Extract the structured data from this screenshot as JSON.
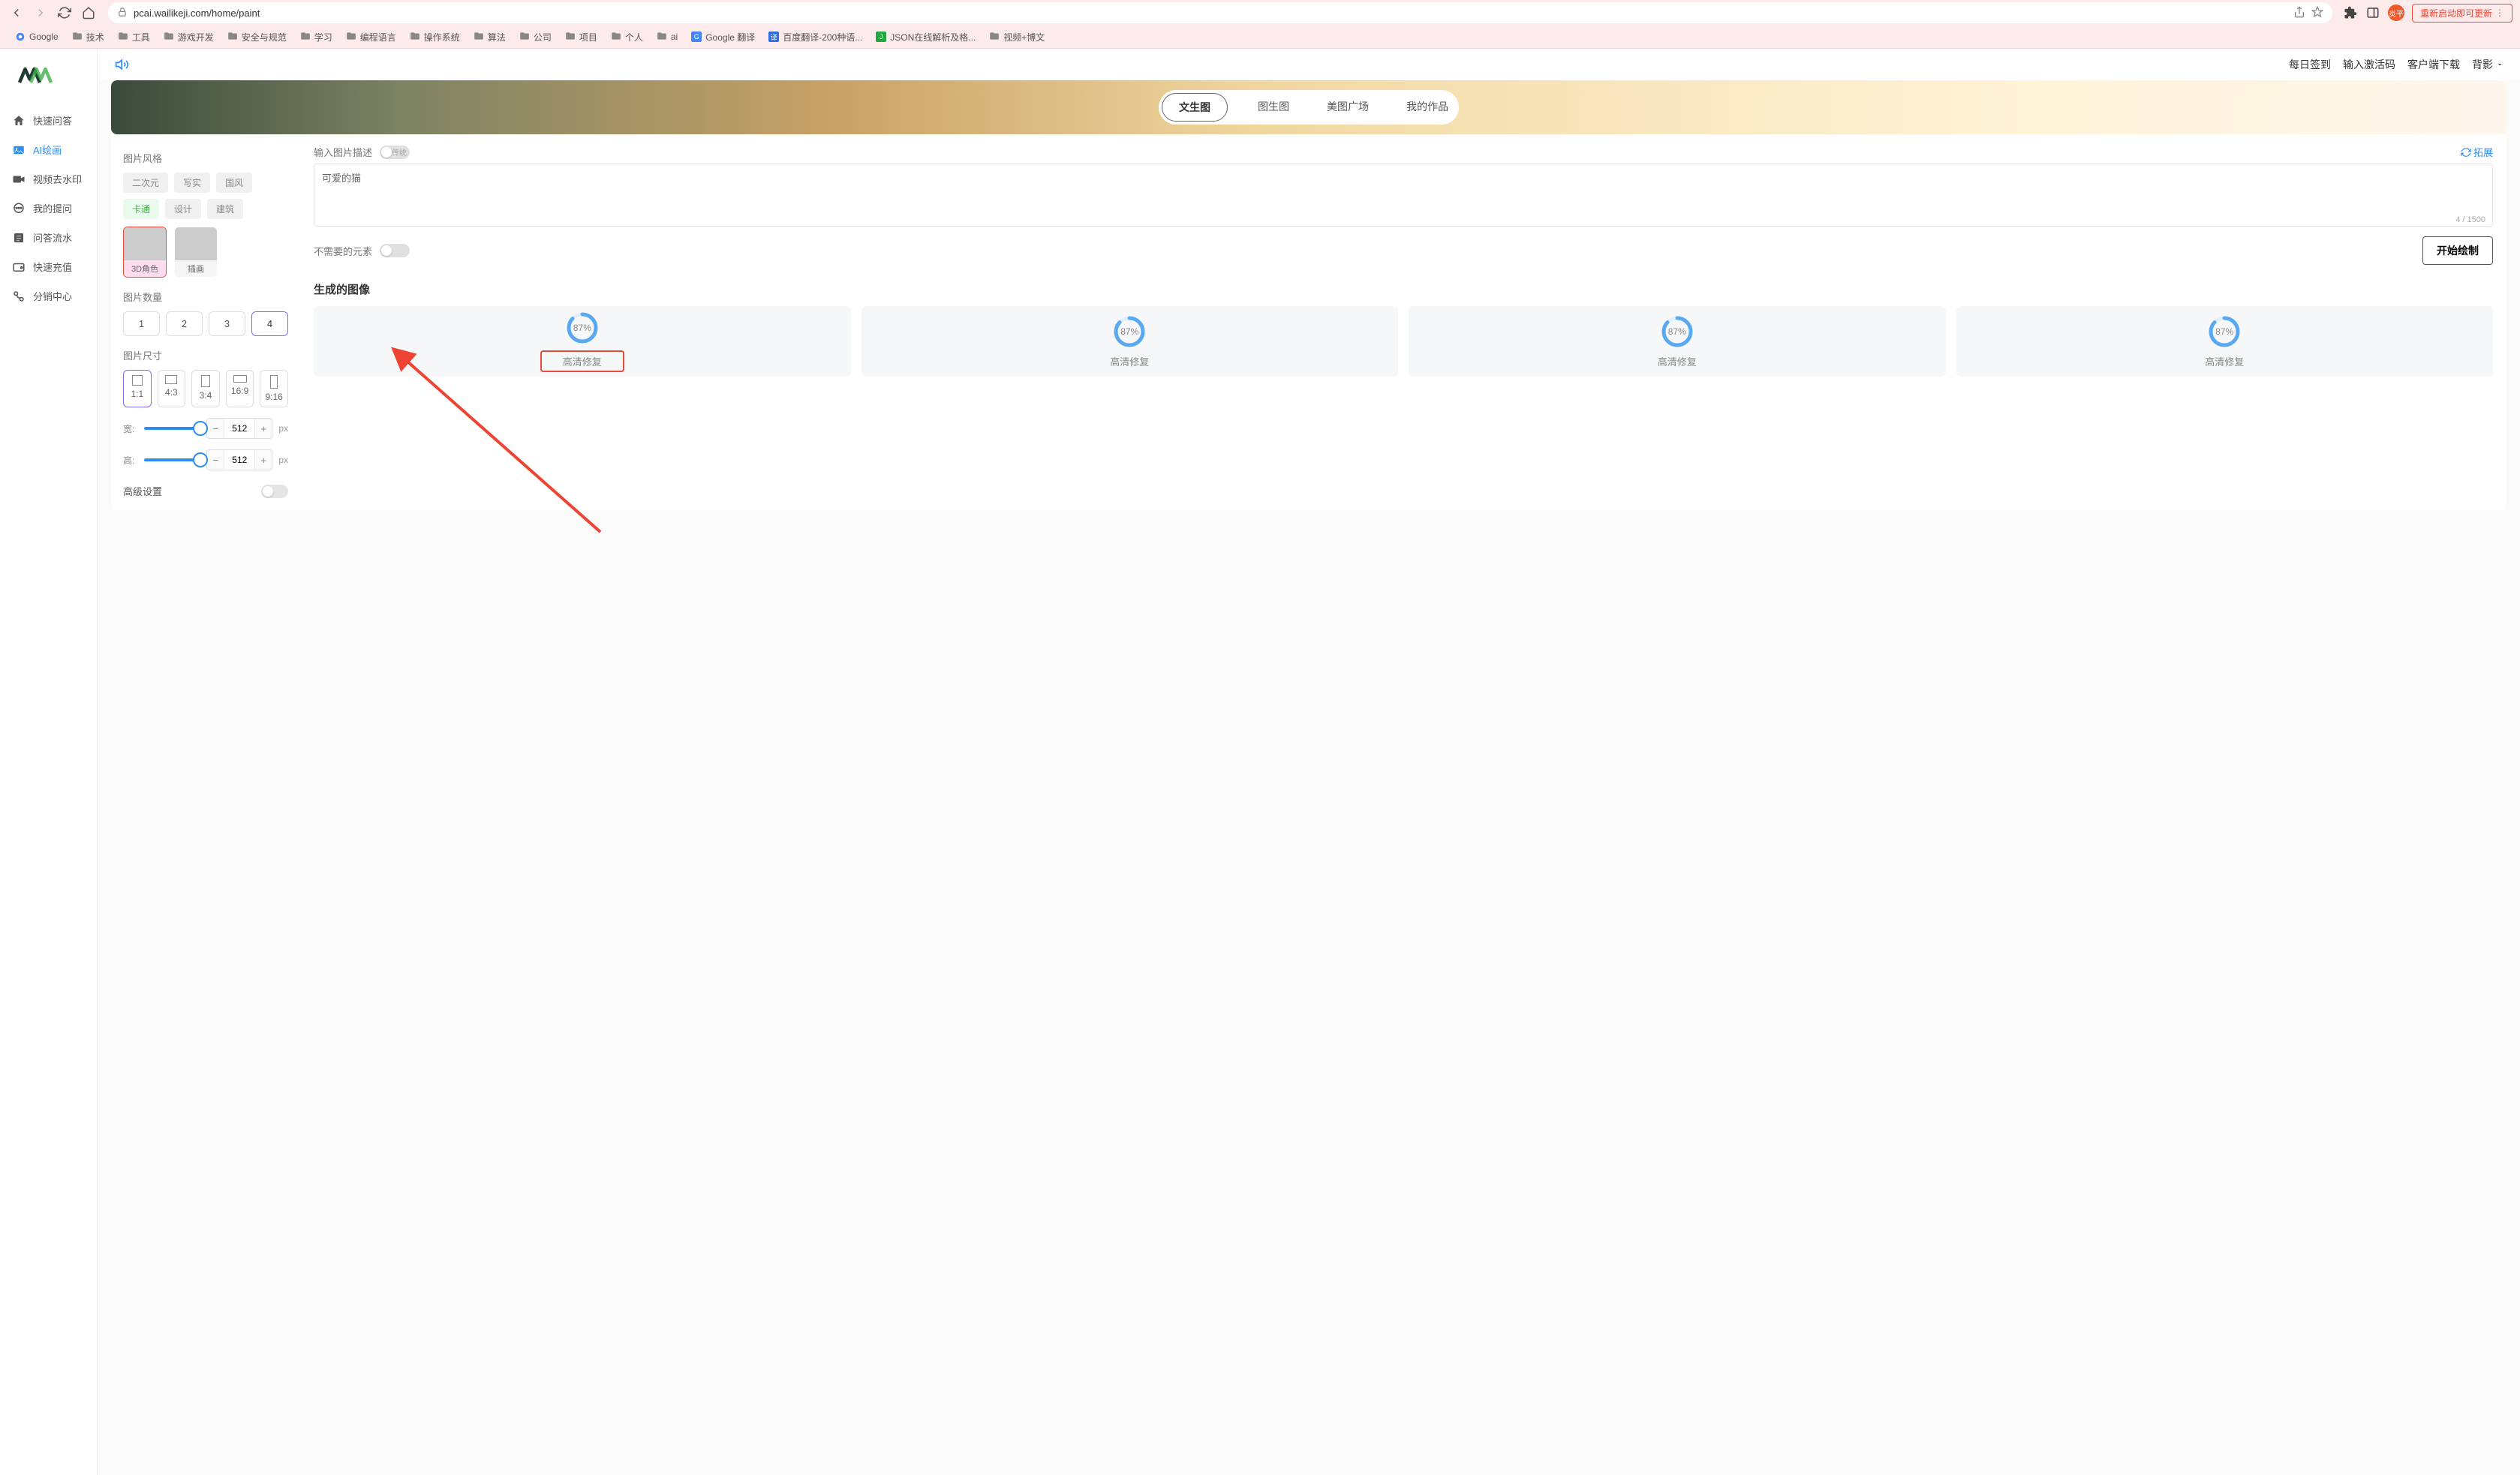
{
  "browser": {
    "url": "pcai.wailikeji.com/home/paint",
    "restart_btn": "重新启动即可更新",
    "avatar_text": "炎平",
    "bookmarks": [
      {
        "label": "Google",
        "kind": "icon"
      },
      {
        "label": "技术",
        "kind": "folder"
      },
      {
        "label": "工具",
        "kind": "folder"
      },
      {
        "label": "游戏开发",
        "kind": "folder"
      },
      {
        "label": "安全与规范",
        "kind": "folder"
      },
      {
        "label": "学习",
        "kind": "folder"
      },
      {
        "label": "编程语言",
        "kind": "folder"
      },
      {
        "label": "操作系统",
        "kind": "folder"
      },
      {
        "label": "算法",
        "kind": "folder"
      },
      {
        "label": "公司",
        "kind": "folder"
      },
      {
        "label": "项目",
        "kind": "folder"
      },
      {
        "label": "个人",
        "kind": "folder"
      },
      {
        "label": "ai",
        "kind": "folder"
      },
      {
        "label": "Google 翻译",
        "kind": "translate"
      },
      {
        "label": "百度翻译-200种语...",
        "kind": "baidu"
      },
      {
        "label": "JSON在线解析及格...",
        "kind": "json"
      },
      {
        "label": "视频+博文",
        "kind": "folder"
      }
    ]
  },
  "sidebar": {
    "items": [
      {
        "icon": "home",
        "label": "快速问答"
      },
      {
        "icon": "image",
        "label": "AI绘画"
      },
      {
        "icon": "video",
        "label": "视频去水印"
      },
      {
        "icon": "chat",
        "label": "我的提问"
      },
      {
        "icon": "list",
        "label": "问答流水"
      },
      {
        "icon": "wallet",
        "label": "快速充值"
      },
      {
        "icon": "share",
        "label": "分销中心"
      }
    ]
  },
  "header": {
    "links": {
      "checkin": "每日签到",
      "activation": "输入激活码",
      "download": "客户端下载",
      "bg": "背影"
    }
  },
  "tabs": [
    "文生图",
    "图生图",
    "美图广场",
    "我的作品"
  ],
  "left_panel": {
    "style_title": "图片风格",
    "style_chips": [
      "二次元",
      "写实",
      "国风",
      "卡通",
      "设计",
      "建筑"
    ],
    "style_thumbs": [
      {
        "caption": "3D角色"
      },
      {
        "caption": "插画"
      }
    ],
    "count_title": "图片数量",
    "count_opts": [
      "1",
      "2",
      "3",
      "4"
    ],
    "size_title": "图片尺寸",
    "size_opts": [
      {
        "label": "1:1",
        "w": 14,
        "h": 14
      },
      {
        "label": "4:3",
        "w": 16,
        "h": 12
      },
      {
        "label": "3:4",
        "w": 12,
        "h": 16
      },
      {
        "label": "16:9",
        "w": 18,
        "h": 10
      },
      {
        "label": "9:16",
        "w": 10,
        "h": 18
      }
    ],
    "dim": {
      "w_label": "宽:",
      "h_label": "高:",
      "w": "512",
      "h": "512",
      "unit": "px"
    },
    "adv_label": "高级设置"
  },
  "right_panel": {
    "desc_label": "输入图片描述",
    "toggle_text": "传统",
    "expand": "拓展",
    "prompt_value": "可爱的猫",
    "counter_cur": "4",
    "counter_max": "1500",
    "counter_sep": " / ",
    "neg_label": "不需要的元素",
    "gen_btn": "开始绘制",
    "gen_title": "生成的图像",
    "progress": "87%",
    "hq_label": "高清修复"
  }
}
